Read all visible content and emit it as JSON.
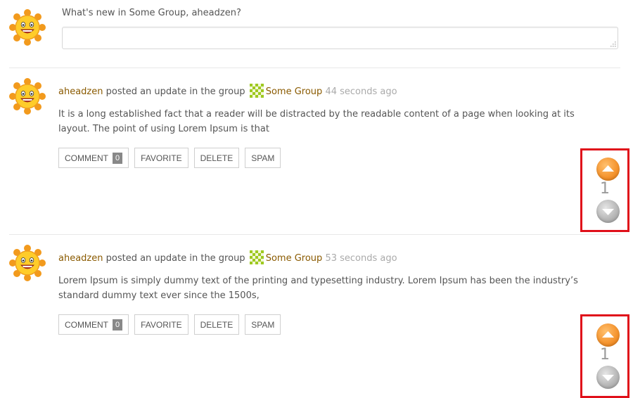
{
  "post_form": {
    "prompt": "What's new in Some Group, aheadzen?",
    "textarea_value": ""
  },
  "activities": [
    {
      "user": "aheadzen",
      "action_text": "posted an update in the group",
      "group": "Some Group",
      "time": "44 seconds ago",
      "content": "It is a long established fact that a reader will be distracted by the readable content of a page when looking at its layout. The point of using Lorem Ipsum is that",
      "buttons": {
        "comment": "COMMENT",
        "comment_count": "0",
        "favorite": "FAVORITE",
        "delete": "DELETE",
        "spam": "SPAM"
      },
      "votes": "1"
    },
    {
      "user": "aheadzen",
      "action_text": "posted an update in the group",
      "group": "Some Group",
      "time": "53 seconds ago",
      "content": "Lorem Ipsum is simply dummy text of the printing and typesetting industry. Lorem Ipsum has been the industry’s standard dummy text ever since the 1500s,",
      "buttons": {
        "comment": "COMMENT",
        "comment_count": "0",
        "favorite": "FAVORITE",
        "delete": "DELETE",
        "spam": "SPAM"
      },
      "votes": "1"
    }
  ],
  "colors": {
    "link": "#8a5a00",
    "timestamp": "#aaaaaa",
    "vote_up": "#f59530",
    "vote_down": "#b8b8b8",
    "highlight": "#e0101a"
  },
  "icons": {
    "avatar": "smiling-sun-avatar-icon",
    "group_avatar": "group-identicon-icon",
    "vote_up": "chevron-up-circle-icon",
    "vote_down": "chevron-down-circle-icon"
  }
}
